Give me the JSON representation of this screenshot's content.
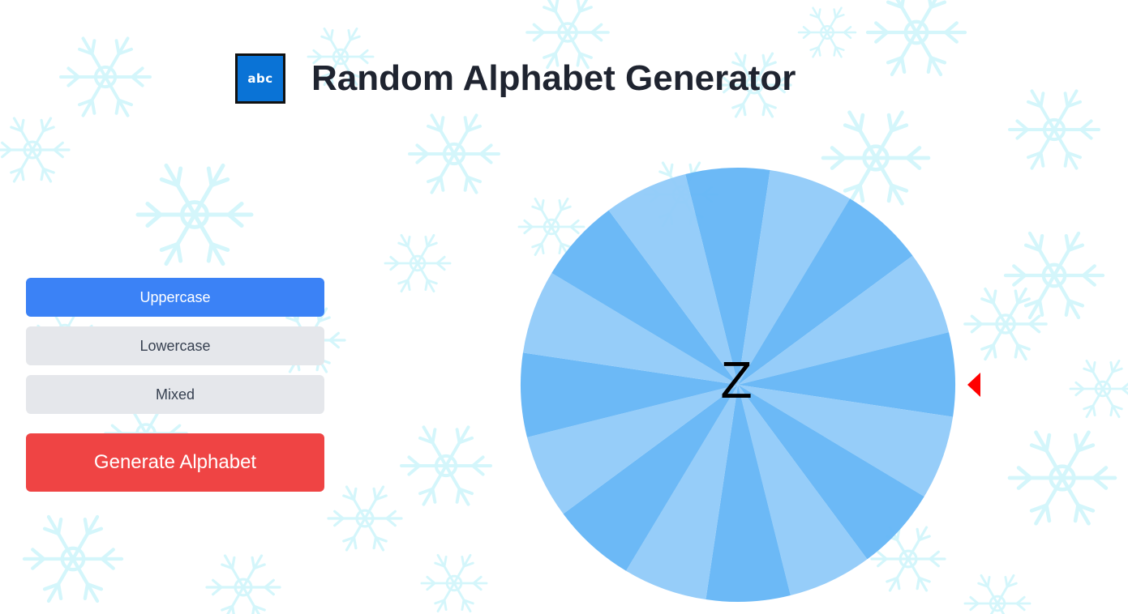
{
  "app": {
    "title": "Random Alphabet Generator",
    "logo_text": "abc"
  },
  "controls": {
    "options": [
      {
        "label": "Uppercase",
        "active": true
      },
      {
        "label": "Lowercase",
        "active": false
      },
      {
        "label": "Mixed",
        "active": false
      }
    ],
    "generate_label": "Generate Alphabet"
  },
  "wheel": {
    "current_letter": "Z",
    "segment_count": 16,
    "colors": [
      "#64b5f6",
      "#90caf9"
    ],
    "pointer_color": "#ff0000",
    "pointer_icon": "triangle-left-icon"
  },
  "colors": {
    "active": "#3b82f6",
    "inactive": "#e5e7eb",
    "generate": "#ef4444",
    "logo": "#0a73d6",
    "snowflake": "#c6f3fa"
  }
}
